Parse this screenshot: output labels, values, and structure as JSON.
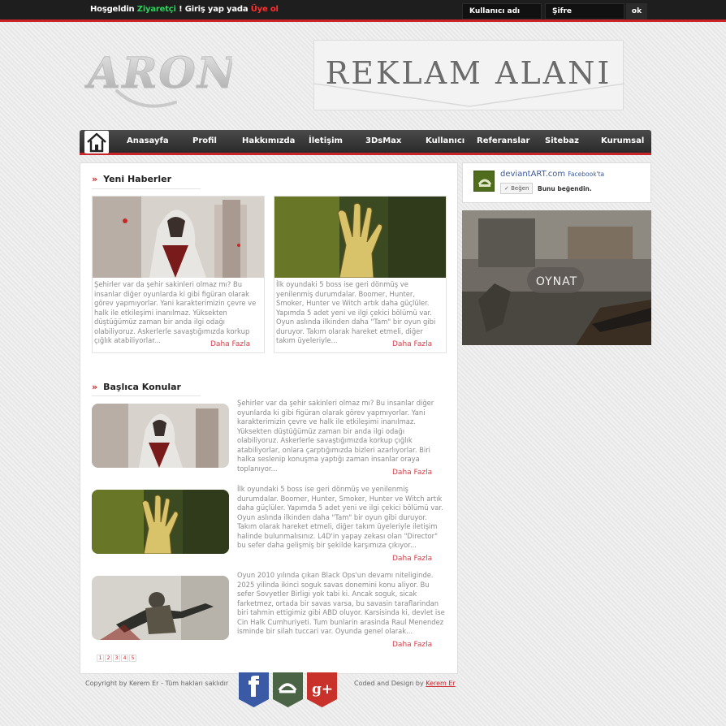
{
  "topbar": {
    "welcome_prefix": "Hoşgeldin",
    "welcome_guest": "Ziyaretçi",
    "welcome_middle": "! Giriş yap yada",
    "welcome_register": "Üye ol",
    "username_placeholder": "Kullanıcı adı",
    "password_placeholder": "Şifre",
    "ok_label": "ok"
  },
  "logo": {
    "text": "ARON"
  },
  "ad": {
    "text": "REKLAM ALANI"
  },
  "nav": {
    "items": [
      "Anasayfa",
      "Profil",
      "Hakkımızda",
      "İletişim",
      "3DsMax",
      "Kullanıcı",
      "Referanslar",
      "Sitebaz",
      "Kurumsal"
    ]
  },
  "news": {
    "arrows": "»",
    "title": "Yeni Haberler",
    "cards": [
      {
        "text": "Şehirler var da şehir sakinleri olmaz mı? Bu insanlar diğer oyunlarda ki gibi figüran olarak görev yapmıyorlar. Yani karakterimizin çevre ve halk ile etkileşimi inanılmaz. Yüksekten düştüğümüz zaman bir anda ilgi odağı olabiliyoruz. Askerlerle savaştığımızda korkup çığlık atabiliyorlar...",
        "more": "Daha Fazla"
      },
      {
        "text": "İlk oyundaki 5 boss ise geri dönmüş ve yenilenmiş durumdalar. Boomer, Hunter, Smoker, Hunter ve Witch artık daha güçlüler. Yapımda 5 adet yeni ve ilgi çekici bölümü var. Oyun aslında ilkinden daha \"Tam\" bir oyun gibi duruyor. Takım olarak hareket etmeli, diğer takım üyeleriyle...",
        "more": "Daha Fazla"
      }
    ]
  },
  "topics": {
    "arrows": "»",
    "title": "Başlıca Konular",
    "items": [
      {
        "text": "Şehirler var da şehir sakinleri olmaz mı? Bu insanlar diğer oyunlarda ki gibi figüran olarak görev yapmıyorlar. Yani karakterimizin çevre ve halk ile etkileşimi inanılmaz. Yüksekten düştüğümüz zaman bir anda ilgi odağı olabiliyoruz. Askerlerle savaştığımızda korkup çığlık atabiliyorlar, onlara çarptığımızda bizleri azarlıyorlar. Biri halka seslenip konuşma yaptığı zaman insanlar oraya toplanıyor...",
        "more": "Daha Fazla"
      },
      {
        "text": "İlk oyundaki 5 boss ise geri dönmüş ve yenilenmiş durumdalar. Boomer, Hunter, Smoker, Hunter ve Witch artık daha güçlüler. Yapımda 5 adet yeni ve ilgi çekici bölümü var. Oyun aslında ilkinden daha \"Tam\" bir oyun gibi duruyor. Takım olarak hareket etmeli, diğer takım üyeleriyle iletişim halinde bulunmalısınız. L4D'in yapay zekası olan \"Director\" bu sefer daha gelişmiş bir şekilde karşımıza çıkıyor...",
        "more": "Daha Fazla"
      },
      {
        "text": "Oyun 2010 yılında çıkan Black Ops'un devamı niteliginde. 2025 yilinda ikinci soguk savas donemini konu aliyor. Bu sefer Sovyetler Birligi yok tabi ki. Ancak soguk, sicak farketmez, ortada bir savas varsa, bu savasin taraflarindan biri tahmin ettigimiz gibi ABD oluyor. Karsisinda ki, devlet ise Cin Halk Cumhuriyeti. Tum bunlarin arasinda Raul Menendez isminde bir silah tuccari var. Oyunda genel olarak...",
        "more": "Daha Fazla"
      }
    ]
  },
  "pager": [
    "1",
    "2",
    "3",
    "4",
    "5"
  ],
  "facebook": {
    "site": "deviantART.com",
    "suffix": "Facebook'ta",
    "like_button": "Beğen",
    "like_text": "Bunu beğendin."
  },
  "game": {
    "play_label": "OYNAT"
  },
  "footer": {
    "copyright": "Copyright by Kerem Er - Tüm hakları saklıdır",
    "credit_prefix": "Coded and Design by",
    "credit_name": "Kerem Er",
    "social_icons": [
      "facebook-icon",
      "deviantart-icon",
      "googleplus-icon"
    ]
  },
  "colors": {
    "accent": "#c8242a",
    "link": "#d2404a",
    "green": "#2bd45a",
    "dark": "#1e1e1e"
  }
}
